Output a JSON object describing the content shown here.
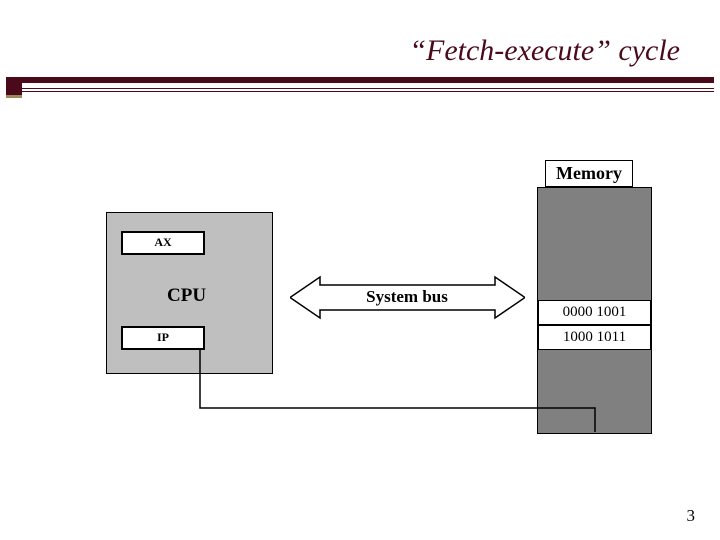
{
  "title": "“Fetch-execute” cycle",
  "memory": {
    "label": "Memory",
    "cells": [
      "0000 1001",
      "1000 1011"
    ]
  },
  "cpu": {
    "label": "CPU",
    "registers": {
      "ax": "AX",
      "ip": "IP"
    }
  },
  "bus": {
    "label": "System bus"
  },
  "page_number": "3"
}
